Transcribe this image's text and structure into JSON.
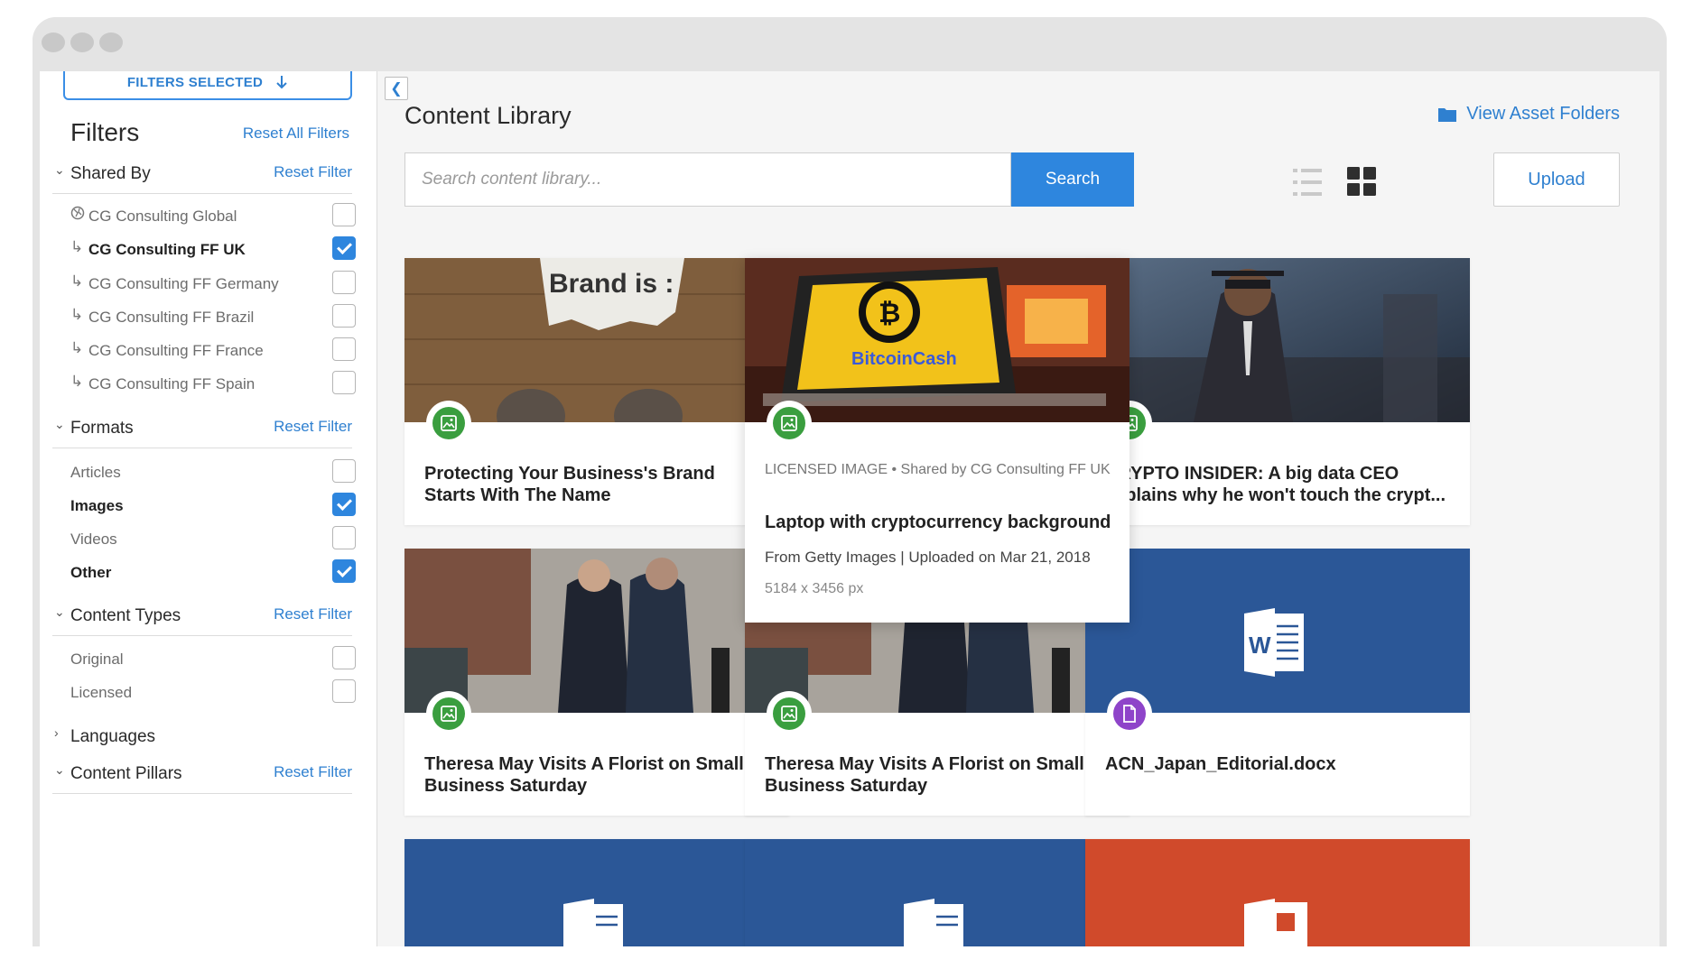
{
  "sidebar": {
    "filters_selected": "FILTERS SELECTED",
    "title": "Filters",
    "reset_all": "Reset All Filters",
    "reset_filter": "Reset Filter",
    "shared_by": {
      "label": "Shared By",
      "options": [
        {
          "label": "CG Consulting Global",
          "checked": false
        },
        {
          "label": "CG Consulting FF UK",
          "checked": true
        },
        {
          "label": "CG Consulting FF Germany",
          "checked": false
        },
        {
          "label": "CG Consulting FF Brazil",
          "checked": false
        },
        {
          "label": "CG Consulting FF France",
          "checked": false
        },
        {
          "label": "CG Consulting FF Spain",
          "checked": false
        }
      ]
    },
    "formats": {
      "label": "Formats",
      "options": [
        {
          "label": "Articles",
          "checked": false
        },
        {
          "label": "Images",
          "checked": true
        },
        {
          "label": "Videos",
          "checked": false
        },
        {
          "label": "Other",
          "checked": true
        }
      ]
    },
    "content_types": {
      "label": "Content Types",
      "options": [
        {
          "label": "Original",
          "checked": false
        },
        {
          "label": "Licensed",
          "checked": false
        }
      ]
    },
    "languages": {
      "label": "Languages"
    },
    "content_pillars": {
      "label": "Content Pillars"
    }
  },
  "main": {
    "title": "Content Library",
    "view_folders": "View Asset Folders",
    "search_placeholder": "Search content library...",
    "search_button": "Search",
    "upload_button": "Upload",
    "thumb_text": {
      "brand": "Brand is :",
      "bitcoin_cash": "BitcoinCash",
      "word_letter": "W"
    },
    "cards": [
      {
        "title": "Protecting Your Business's Brand Starts With The Name",
        "type": "image"
      },
      {
        "title": "Laptop with cryptocurrency background",
        "type": "image",
        "meta": "LICENSED IMAGE • Shared by CG Consulting FF UK",
        "source": "From Getty Images | Uploaded on Mar 21, 2018",
        "dimensions": "5184 x 3456 px"
      },
      {
        "title": "CRYPTO INSIDER: A big data CEO explains why he won't touch the crypt...",
        "type": "image"
      },
      {
        "title": "Theresa May Visits A Florist on Small Business Saturday",
        "type": "image"
      },
      {
        "title": "Theresa May Visits A Florist on Small Business Saturday",
        "type": "image"
      },
      {
        "title": "ACN_Japan_Editorial.docx",
        "type": "document"
      }
    ]
  },
  "colors": {
    "accent": "#2e86de",
    "image_badge": "#3a9e3f",
    "doc_badge": "#8e44c9",
    "word_blue": "#2b5797",
    "ppt_orange": "#d04a2b"
  }
}
